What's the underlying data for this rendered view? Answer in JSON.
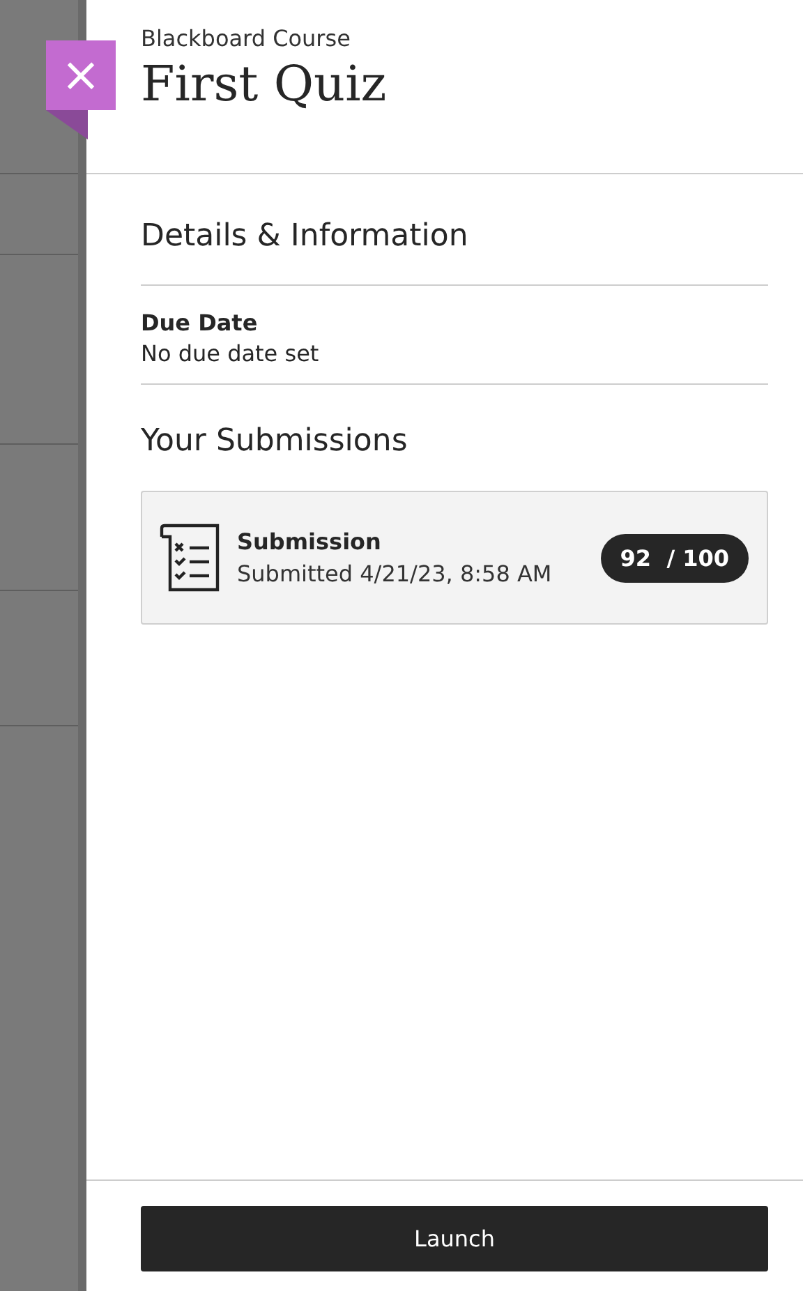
{
  "header": {
    "course": "Blackboard Course",
    "title": "First Quiz",
    "close_icon": "×"
  },
  "details": {
    "heading": "Details & Information",
    "due_label": "Due Date",
    "due_value": "No due date set"
  },
  "submissions": {
    "heading": "Your Submissions",
    "items": [
      {
        "title": "Submission",
        "date": "Submitted 4/21/23, 8:58 AM",
        "grade": "92  / 100"
      }
    ]
  },
  "footer": {
    "button": "Launch"
  }
}
